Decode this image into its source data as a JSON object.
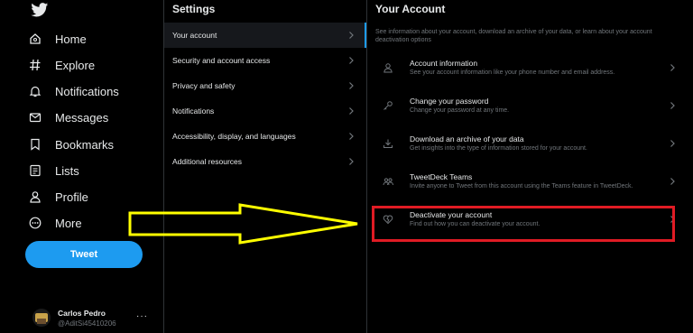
{
  "nav": {
    "items": [
      {
        "label": "Home",
        "icon": "home-icon"
      },
      {
        "label": "Explore",
        "icon": "hashtag-icon"
      },
      {
        "label": "Notifications",
        "icon": "bell-icon"
      },
      {
        "label": "Messages",
        "icon": "envelope-icon"
      },
      {
        "label": "Bookmarks",
        "icon": "bookmark-icon"
      },
      {
        "label": "Lists",
        "icon": "list-icon"
      },
      {
        "label": "Profile",
        "icon": "person-icon"
      },
      {
        "label": "More",
        "icon": "more-circle-icon"
      }
    ],
    "tweet_label": "Tweet",
    "account": {
      "name": "Carlos Pedro",
      "handle": "@AditSi45410206",
      "more": "···"
    }
  },
  "settings": {
    "title": "Settings",
    "items": [
      {
        "label": "Your account"
      },
      {
        "label": "Security and account access"
      },
      {
        "label": "Privacy and safety"
      },
      {
        "label": "Notifications"
      },
      {
        "label": "Accessibility, display, and languages"
      },
      {
        "label": "Additional resources"
      }
    ]
  },
  "account": {
    "title": "Your Account",
    "description": "See information about your account, download an archive of your data, or learn about your account deactivation options",
    "items": [
      {
        "title": "Account information",
        "desc": "See your account information like your phone number and email address.",
        "icon": "person-icon"
      },
      {
        "title": "Change your password",
        "desc": "Change your password at any time.",
        "icon": "key-icon"
      },
      {
        "title": "Download an archive of your data",
        "desc": "Get insights into the type of information stored for your account.",
        "icon": "download-icon"
      },
      {
        "title": "TweetDeck Teams",
        "desc": "Invite anyone to Tweet from this account using the Teams feature in TweetDeck.",
        "icon": "team-icon"
      },
      {
        "title": "Deactivate your account",
        "desc": "Find out how you can deactivate your account.",
        "icon": "broken-heart-icon"
      }
    ]
  },
  "colors": {
    "accent": "#1d9bf0",
    "highlight": "#e01b24",
    "arrow": "#ffff00"
  }
}
